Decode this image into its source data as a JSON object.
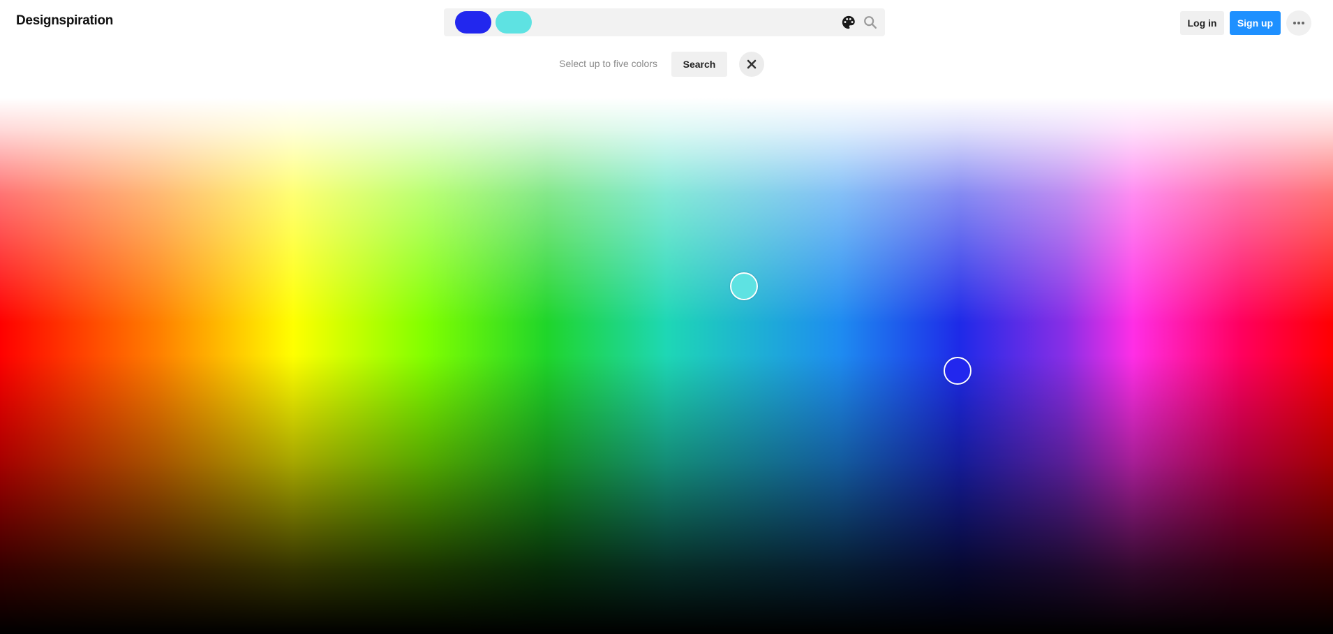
{
  "header": {
    "logo": "Designspiration",
    "search": {
      "selected_colors": [
        "#2227ee",
        "#5ee2e2"
      ],
      "palette_icon": "palette-icon",
      "search_icon": "search-icon"
    },
    "login_label": "Log in",
    "signup_label": "Sign up",
    "more_icon": "ellipsis-icon"
  },
  "toolbar": {
    "hint": "Select up to five colors",
    "search_label": "Search",
    "close_icon": "close-icon"
  },
  "picker": {
    "markers": [
      {
        "color": "#2227ee"
      },
      {
        "color": "#5ee2e2"
      }
    ]
  },
  "colors": {
    "accent": "#1e90ff",
    "button_bg": "#f0f0f0"
  }
}
